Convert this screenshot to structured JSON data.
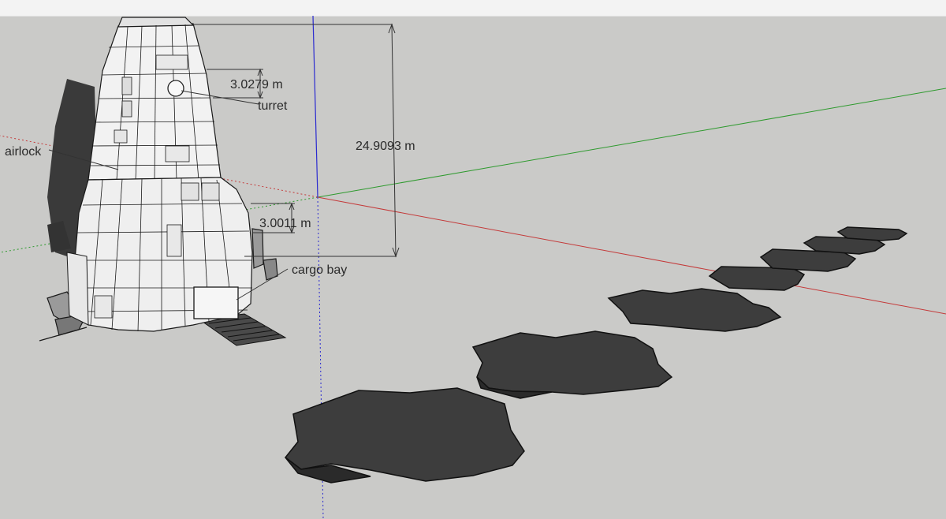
{
  "model": {
    "labels": {
      "airlock": "airlock",
      "turret": "turret",
      "cargo_bay": "cargo bay"
    },
    "dimensions": {
      "turret_height": "3.0279 m",
      "total_height": "24.9093 m",
      "cargo_bay_height": "3.0011 m"
    }
  },
  "colors": {
    "background": "#cacac8",
    "axis_red": "#c43a3a",
    "axis_green": "#2e9a2e",
    "axis_blue": "#2a2ad0",
    "shadow": "#3c3c3c",
    "model_face": "#f2f2f2",
    "edge": "#1a1a1a"
  }
}
